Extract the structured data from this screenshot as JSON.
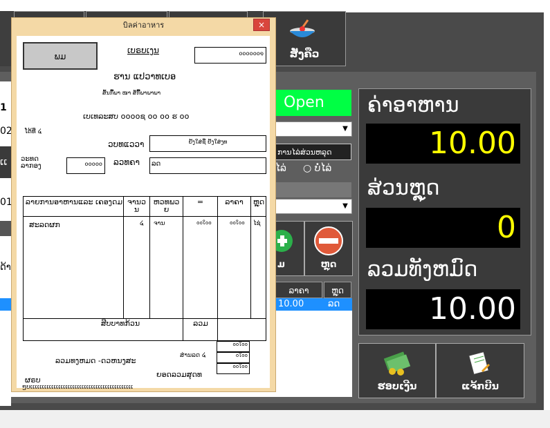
{
  "topbar": {
    "order_button_label": "ສັ່ງຄືວ"
  },
  "main": {
    "open_status": "Open",
    "discount_type_label": "ການໄລ່ສ່ວນຫລຸດ",
    "radio_option_label": "ບໍ່ໄລ່",
    "radio_option_prefix": "ໄລ່",
    "add_button_label": "ມ",
    "remove_button_label": "ຫຼຸດ",
    "table_headers": [
      "ລາຄາ",
      "ຫຼຸດ"
    ],
    "selected_row": {
      "price": "10.00",
      "discount": "ລດ"
    },
    "left_fragments": [
      "1",
      "02",
      "ເເ",
      "01",
      "ດ້າ",
      "າ"
    ]
  },
  "summary": {
    "food_label": "ຄ່າອາຫານ",
    "food_value": "10.00",
    "discount_label": "ສ່ວນຫຼຸດ",
    "discount_value": "0",
    "total_label": "ລວມທັງຫມົດ",
    "total_value": "10.00"
  },
  "bottom_buttons": {
    "receive_label": "ຮອບເງີນ",
    "edit_bill_label": "ແຈ້ກບີນ"
  },
  "dialog": {
    "title": "บิลค่าอาหาร",
    "close": "×",
    "print_button": "ພມ",
    "bill_number_label": "ເບຣບເງນ",
    "bill_number_value": "໐໐໐໐໐໐໑",
    "shop_name": "ຮານ ແປວາທເບອ",
    "address": "ສົ້ນກົ້ີ້ພາ ໜາ ສັກົ້ີ້ີ້ພາພາພາ",
    "phone": "ເບເທລະສບ ໐໐໐໐ຊ ໐໐ ໐໐ ຮ ໐໐",
    "table_label": "ໂຕ້ທີ່ ໔",
    "user_label": "ວບທແວວາ",
    "user_value": "ຢັງໃສ່ຊື່ ຢັງໃສ່ງທ",
    "time_label": "ວະທດ ລາກອງ",
    "time_value": "໐໐໐໐໐",
    "date_label": "ລວທຄາ",
    "date_value": "ລດ",
    "col_headers": [
      "ລາຍການອາຫານແລະ ເຄອງດມ",
      "ຈານວ ນ",
      "ຫວທພວ ຍ",
      "=",
      "ລາຄາ",
      "ຫຼຸດ"
    ],
    "item": {
      "name": "ສະລດຜກ",
      "qty": "໔",
      "unit": "ຈານ",
      "price": "໐໐ໃ໐໐",
      "total": "໐໐ໃ໐໐",
      "disc": "ໄຊ່"
    },
    "summary_text": "ສີບບາທກ້ວນ",
    "sum_label": "ລວມ",
    "sum_value": "໐໐ໃ໐໐",
    "discount_label": "ສ່ານລດ ໔",
    "discount_value": "໐ໃ໐໐",
    "total_label": "ລວມທງຫມດ -ດວຫນງສະ",
    "grand_label": "ຍອດລວມສຸດທ",
    "grand_value": "໐໐ໃ໐໐",
    "footer_line1": "ຜຣບ",
    "footer_line2": "ໆບເເເເເເເເເເເເເເເເເເເເເເເເເເເເເເເເເເເເເເເເເເເເ"
  }
}
